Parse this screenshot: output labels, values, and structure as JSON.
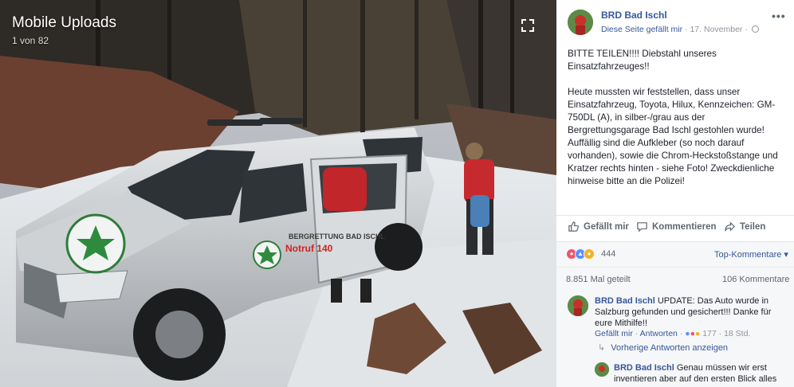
{
  "viewer": {
    "album_title": "Mobile Uploads",
    "photo_counter": "1 von 82",
    "vehicle_door_text": "BERGRETTUNG BAD ISCHL",
    "vehicle_notruf_text": "Notruf 140"
  },
  "post": {
    "page_name": "BRD Bad Ischl",
    "liked_label": "Diese Seite gefällt mir",
    "date": "17. November",
    "more_label": "•••",
    "paragraphs": [
      "BITTE TEILEN!!!! Diebstahl unseres Einsatzfahrzeuges!!",
      "Heute mussten wir feststellen, dass unser Einsatzfahrzeug, Toyota, Hilux, Kennzeichen: GM-750DL (A), in silber-/grau aus der Bergrettungsgarage Bad Ischl gestohlen wurde! Auffällig sind die Aufkleber (so noch darauf vorhanden), sowie die Chrom-Heckstoßstange und Kratzer rechts hinten - siehe Foto! Zweckdienliche hinweise bitte an die Polizei!"
    ]
  },
  "actions": {
    "like": "Gefällt mir",
    "comment": "Kommentieren",
    "share": "Teilen"
  },
  "reactions": {
    "count": "444",
    "sort_label": "Top-Kommentare ▾",
    "colors": [
      "#f25268",
      "#5890ff",
      "#f7b125"
    ]
  },
  "stats": {
    "shares": "8.851 Mal geteilt",
    "comments": "106 Kommentare"
  },
  "comments": [
    {
      "author": "BRD Bad Ischl",
      "text": "UPDATE: Das Auto wurde in Salzburg gefunden und gesichert!!! Danke für eure Mithilfe!!",
      "like_label": "Gefällt mir",
      "reply_label": "Antworten",
      "reaction_count": "177",
      "age": "18 Std."
    }
  ],
  "previous_replies": "Vorherige Antworten anzeigen",
  "reply": {
    "author": "BRD Bad Ischl",
    "text": "Genau müssen wir erst inventieren aber auf den ersten Blick alles"
  }
}
